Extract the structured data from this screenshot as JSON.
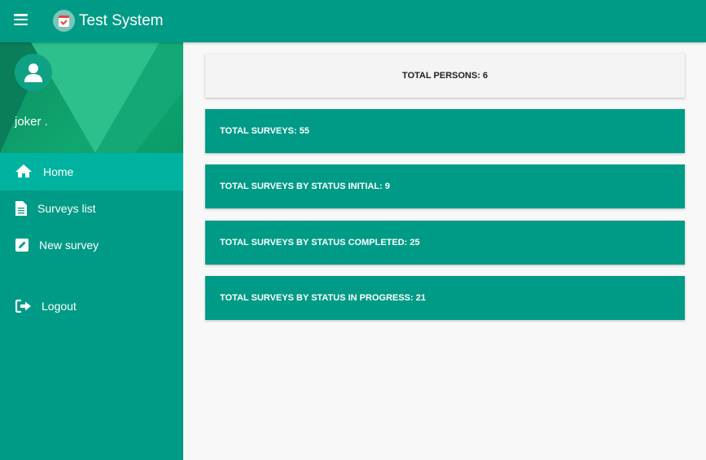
{
  "app": {
    "title": "Test System",
    "accent_color": "#009b86"
  },
  "topbar": {
    "menu_icon": "hamburger-menu-icon",
    "logo_icon": "checklist-logo-icon"
  },
  "sidebar": {
    "user": {
      "name": "joker .",
      "avatar_icon": "user-avatar-icon"
    },
    "items": [
      {
        "label": "Home",
        "icon": "home-icon",
        "active": true
      },
      {
        "label": "Surveys list",
        "icon": "document-icon",
        "active": false
      },
      {
        "label": "New survey",
        "icon": "edit-icon",
        "active": false
      },
      {
        "label": "Logout",
        "icon": "logout-icon",
        "active": false
      }
    ]
  },
  "stats": [
    {
      "text": "TOTAL PERSONS: 6",
      "style": "light"
    },
    {
      "text": "TOTAL SURVEYS: 55",
      "style": "teal"
    },
    {
      "text": "TOTAL SURVEYS BY STATUS INITIAL: 9",
      "style": "teal"
    },
    {
      "text": "TOTAL SURVEYS BY STATUS COMPLETED: 25",
      "style": "teal"
    },
    {
      "text": "TOTAL SURVEYS BY STATUS IN PROGRESS: 21",
      "style": "teal"
    }
  ]
}
